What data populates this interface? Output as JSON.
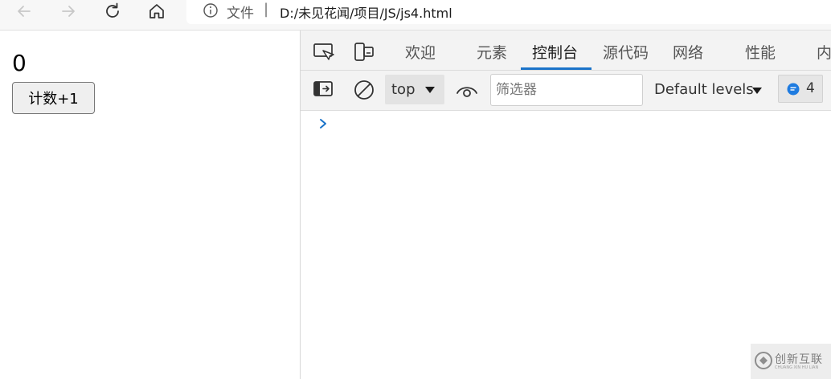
{
  "browser": {
    "address_scheme_label": "文件",
    "address_separator": "|",
    "address_url": "D:/未见花闻/项目/JS/js4.html"
  },
  "page": {
    "count_value": "0",
    "increment_button_label": "计数+1"
  },
  "devtools": {
    "tabs": [
      {
        "label": "欢迎",
        "active": false
      },
      {
        "label": "元素",
        "active": false
      },
      {
        "label": "控制台",
        "active": true
      },
      {
        "label": "源代码",
        "active": false
      },
      {
        "label": "网络",
        "active": false
      },
      {
        "label": "性能",
        "active": false
      },
      {
        "label": "内",
        "active": false
      }
    ],
    "toolbar": {
      "context_label": "top",
      "filter_placeholder": "筛选器",
      "filter_value": "",
      "levels_label": "Default levels",
      "message_count": "4"
    }
  },
  "watermark": {
    "text": "创新互联",
    "sub_text": "CHUANG XIN HU LIAN"
  },
  "colors": {
    "accent": "#1a73c9",
    "badge_blue": "#1e7be0",
    "prompt_blue": "#1a73c9"
  }
}
